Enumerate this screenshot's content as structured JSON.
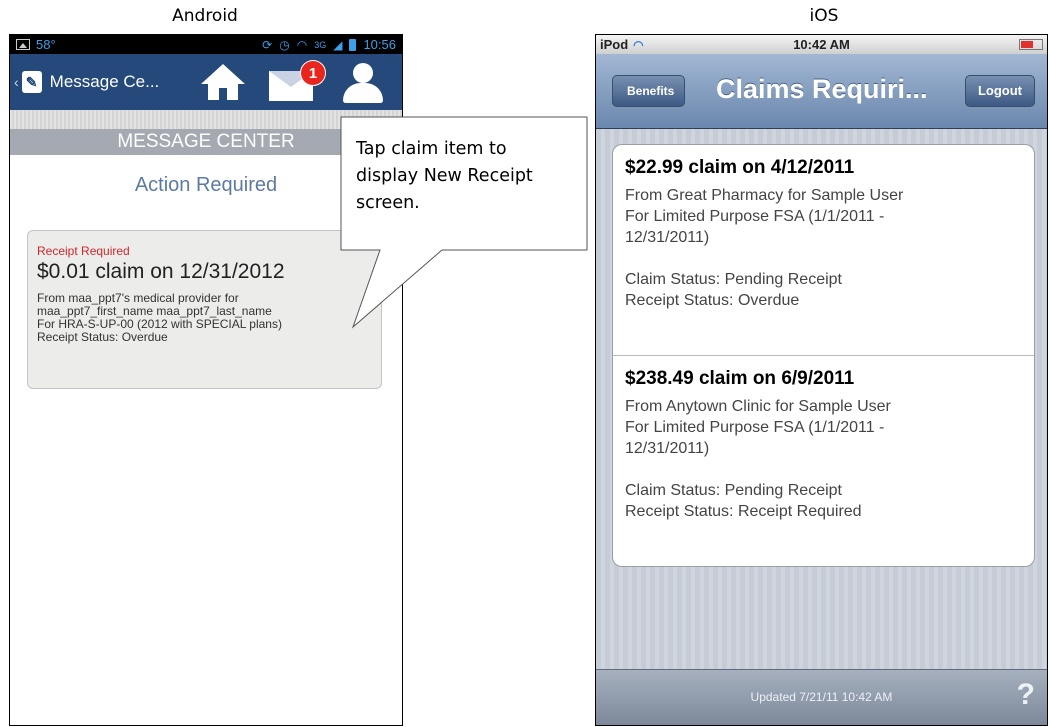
{
  "labels": {
    "android": "Android",
    "ios": "iOS"
  },
  "android": {
    "status": {
      "temp": "58°",
      "net": "3G",
      "time": "10:56"
    },
    "actionbar": {
      "title": "Message Ce...",
      "badge_count": "1"
    },
    "section_header": "MESSAGE CENTER",
    "subheader": "Action Required",
    "claim": {
      "tag": "Receipt Required",
      "amount": "$0.01 claim on 12/31/2012",
      "lines": [
        "From maa_ppt7's medical provider for",
        "maa_ppt7_first_name maa_ppt7_last_name",
        "For HRA-S-UP-00 (2012 with SPECIAL plans)",
        "Receipt Status: Overdue"
      ]
    }
  },
  "callout": {
    "lines": [
      "Tap claim item to",
      "display New Receipt",
      "screen."
    ]
  },
  "ios": {
    "status": {
      "carrier": "iPod",
      "time": "10:42 AM"
    },
    "nav": {
      "back_label": "Benefits",
      "title": "Claims Requiri...",
      "right_label": "Logout"
    },
    "claims": [
      {
        "amount": "$22.99 claim on 4/12/2011",
        "lines": [
          "From Great Pharmacy for Sample User",
          "For Limited Purpose FSA (1/1/2011 -",
          "12/31/2011)"
        ],
        "status_lines": [
          "Claim Status: Pending Receipt",
          "Receipt Status: Overdue"
        ]
      },
      {
        "amount": "$238.49 claim on 6/9/2011",
        "lines": [
          "From Anytown Clinic for Sample User",
          "For Limited Purpose FSA (1/1/2011 -",
          "12/31/2011)"
        ],
        "status_lines": [
          "Claim Status: Pending Receipt",
          "Receipt Status: Receipt Required"
        ]
      }
    ],
    "bottom": {
      "updated": "Updated 7/21/11 10:42 AM",
      "help": "?"
    }
  },
  "colors": {
    "android_actionbar": "#24497a",
    "android_header": "#a4a9b2",
    "android_subheader": "#5c7ba3",
    "receipt_required_red": "#d0262a",
    "badge_red": "#e8261e",
    "ios_nav": "#6a87ad"
  }
}
